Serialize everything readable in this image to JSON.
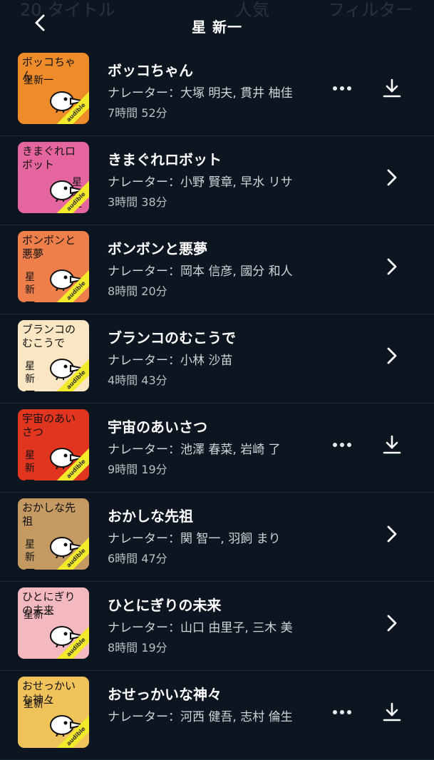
{
  "header": {
    "title": "星 新一",
    "back_icon": "chevron-left-icon",
    "ghost_left": "20 タイトル",
    "ghost_center": "人気",
    "ghost_right": "フィルター"
  },
  "colors": {
    "background": "#0d1520",
    "divider": "#1e2a36",
    "text": "#ffffff",
    "secondary_text": "#cfd5db",
    "stripe_yellow": "#f2ea2a"
  },
  "books": [
    {
      "title": "ボッコちゃん",
      "narrator": "ナレーター：大塚 明夫, 貫井 柚佳",
      "duration": "7時間 52分",
      "action": "download",
      "cover": {
        "bg": "#ef8c2a",
        "title": "ボッコちゃん",
        "author": "星新一",
        "author_style": "h"
      }
    },
    {
      "title": "きまぐれロボット",
      "narrator": "ナレーター：小野 賢章, 早水 リサ",
      "duration": "3時間 38分",
      "action": "chevron",
      "cover": {
        "bg": "#e5659f",
        "title": "きまぐれロボット",
        "author": "星新一",
        "author_style": "v"
      }
    },
    {
      "title": "ボンボンと悪夢",
      "narrator": "ナレーター：岡本 信彦, 國分 和人",
      "duration": "8時間 20分",
      "action": "chevron",
      "cover": {
        "bg": "#ee7f4a",
        "title": "ボンボンと悪夢",
        "author": "星新一",
        "author_style": "vl"
      }
    },
    {
      "title": "ブランコのむこうで",
      "narrator": "ナレーター：小林 沙苗",
      "duration": "4時間 43分",
      "action": "chevron",
      "cover": {
        "bg": "#fae6c3",
        "title": "ブランコのむこうで",
        "author": "星新一",
        "author_style": "vl"
      }
    },
    {
      "title": "宇宙のあいさつ",
      "narrator": "ナレーター：池澤 春菜, 岩崎 了",
      "duration": "9時間 19分",
      "action": "download",
      "cover": {
        "bg": "#e2351f",
        "title": "宇宙のあいさつ",
        "author": "星新一",
        "author_style": "vl"
      }
    },
    {
      "title": "おかしな先祖",
      "narrator": "ナレーター：関 智一, 羽飼 まり",
      "duration": "6時間 47分",
      "action": "chevron",
      "cover": {
        "bg": "#c49a62",
        "title": "おかしな先祖",
        "author": "星新一",
        "author_style": "vl"
      }
    },
    {
      "title": "ひとにぎりの未来",
      "narrator": "ナレーター：山口 由里子, 三木 美",
      "duration": "8時間 19分",
      "action": "chevron",
      "cover": {
        "bg": "#f4b8bf",
        "title": "ひとにぎりの未来",
        "author": "星新一",
        "author_style": "h"
      }
    },
    {
      "title": "おせっかいな神々",
      "narrator": "ナレーター：河西 健吾, 志村 倫生",
      "duration": "",
      "action": "download",
      "cover": {
        "bg": "#f0c25a",
        "title": "おせっかいな神々",
        "author": "星新一",
        "author_style": "h"
      }
    }
  ],
  "icons": {
    "more": "more-dots-icon",
    "download": "download-icon",
    "chevron": "chevron-right-icon",
    "bird": "bird-icon"
  },
  "stripe_label": "audible"
}
